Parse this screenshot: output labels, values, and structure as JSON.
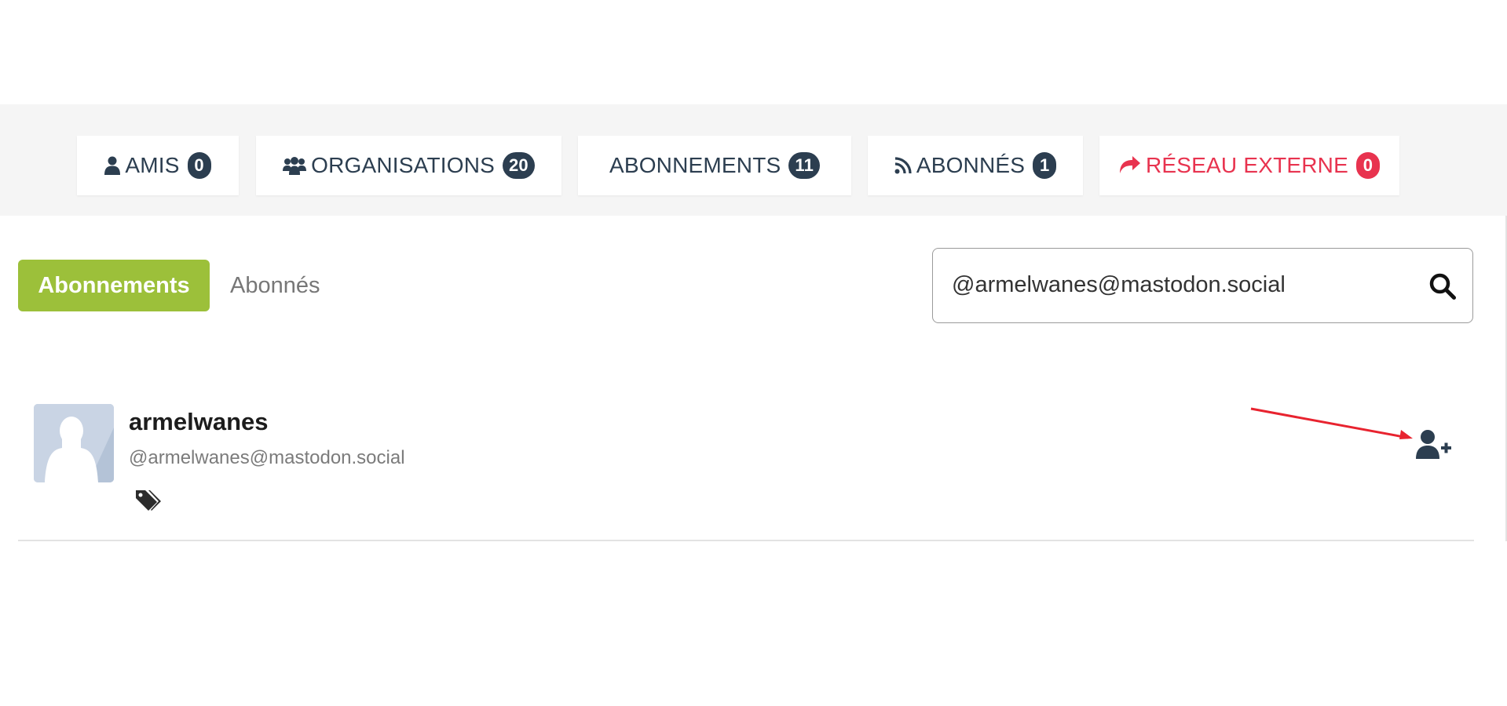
{
  "tabs": [
    {
      "label": "AMIS",
      "count": "0",
      "icon": "user-icon"
    },
    {
      "label": "ORGANISATIONS",
      "count": "20",
      "icon": "users-icon"
    },
    {
      "label": "ABONNEMENTS",
      "count": "11",
      "icon": ""
    },
    {
      "label": "ABONNÉS",
      "count": "1",
      "icon": "rss-icon"
    },
    {
      "label": "RÉSEAU EXTERNE",
      "count": "0",
      "icon": "share-icon"
    }
  ],
  "toggle": {
    "active_label": "Abonnements",
    "inactive_label": "Abonnés"
  },
  "search": {
    "value": "@armelwanes@mastodon.social"
  },
  "result": {
    "name": "armelwanes",
    "handle": "@armelwanes@mastodon.social"
  },
  "colors": {
    "dark_navy": "#2c3e50",
    "accent_red": "#e8334f",
    "accent_green": "#9cc03a",
    "annotation_arrow": "#e8232f"
  }
}
